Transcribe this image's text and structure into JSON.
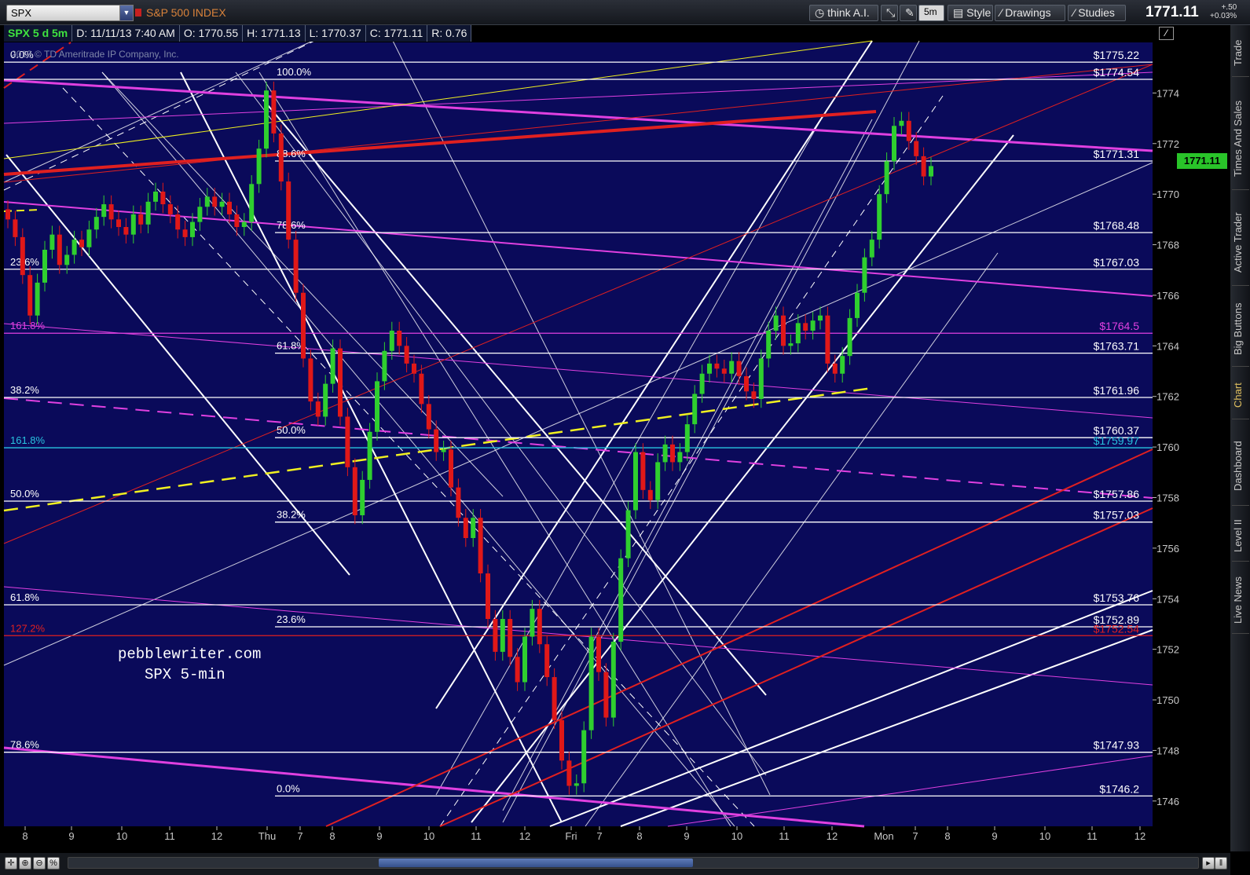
{
  "toolbar": {
    "symbol": "SPX",
    "symbol_name": "S&P 500 INDEX",
    "think_ai": "think A.I.",
    "interval": "5m",
    "style": "Style",
    "drawings": "Drawings",
    "studies": "Studies",
    "last_price": "1771.11",
    "net_change": "+.50",
    "pct_change": "+0.03%"
  },
  "infobar": {
    "study": "SPX 5 d 5m",
    "date": "D: 11/11/13 7:40 AM",
    "open": "O: 1770.55",
    "high": "H: 1771.13",
    "low": "L: 1770.37",
    "close": "C: 1771.11",
    "range": "R: 0.76"
  },
  "copyright": "2013 © TD Ameritrade IP Company, Inc.",
  "watermark": {
    "line1": "pebblewriter.com",
    "line2": "SPX 5-min"
  },
  "sidebar_tabs": [
    "Trade",
    "Times And Sales",
    "Active Trader",
    "Big Buttons",
    "Chart",
    "Dashboard",
    "Level II",
    "Live News"
  ],
  "colors": {
    "chart_bg": "#0a0a5a",
    "up": "#2fcf2f",
    "down": "#e01818",
    "magenta": "#e040e0",
    "yellow": "#f0f020",
    "cyan": "#29c4e0",
    "red_line": "#e02020"
  },
  "chart_data": {
    "type": "candlestick",
    "title": "SPX 5 d 5m",
    "ylim": [
      1745,
      1776
    ],
    "y_ticks": [
      1746,
      1748,
      1750,
      1752,
      1754,
      1756,
      1758,
      1760,
      1762,
      1764,
      1766,
      1768,
      1770,
      1772,
      1774
    ],
    "x_labels": [
      "8",
      "9",
      "10",
      "11",
      "12",
      "Thu",
      "7",
      "8",
      "9",
      "10",
      "11",
      "12",
      "Fri",
      "7",
      "8",
      "9",
      "10",
      "11",
      "12",
      "Mon",
      "7",
      "8",
      "9",
      "10",
      "11",
      "12"
    ],
    "current_price_label": "1771.11",
    "right_levels": [
      {
        "label": "$1775.22",
        "value": 1775.22,
        "color": "#ffffff"
      },
      {
        "label": "$1774.54",
        "value": 1774.54,
        "color": "#ffffff"
      },
      {
        "label": "$1771.31",
        "value": 1771.31,
        "color": "#ffffff"
      },
      {
        "label": "$1768.48",
        "value": 1768.48,
        "color": "#ffffff"
      },
      {
        "label": "$1767.03",
        "value": 1767.03,
        "color": "#ffffff"
      },
      {
        "label": "$1764.5",
        "value": 1764.5,
        "color": "#e040e0"
      },
      {
        "label": "$1763.71",
        "value": 1763.71,
        "color": "#ffffff"
      },
      {
        "label": "$1761.96",
        "value": 1761.96,
        "color": "#ffffff"
      },
      {
        "label": "$1760.37",
        "value": 1760.37,
        "color": "#ffffff"
      },
      {
        "label": "$1759.97",
        "value": 1759.97,
        "color": "#29c4e0"
      },
      {
        "label": "$1757.86",
        "value": 1757.86,
        "color": "#ffffff"
      },
      {
        "label": "$1757.03",
        "value": 1757.03,
        "color": "#ffffff"
      },
      {
        "label": "$1753.76",
        "value": 1753.76,
        "color": "#ffffff"
      },
      {
        "label": "$1752.89",
        "value": 1752.89,
        "color": "#ffffff"
      },
      {
        "label": "$1752.54",
        "value": 1752.54,
        "color": "#e02020"
      },
      {
        "label": "$1747.93",
        "value": 1747.93,
        "color": "#ffffff"
      },
      {
        "label": "$1746.2",
        "value": 1746.2,
        "color": "#ffffff"
      }
    ],
    "fib_labels_left": [
      {
        "text": "0.0%",
        "value": 1775.22,
        "color": "#ffffff"
      },
      {
        "text": "23.6%",
        "value": 1767.03,
        "color": "#ffffff"
      },
      {
        "text": "161.8%",
        "value": 1764.5,
        "color": "#e040e0"
      },
      {
        "text": "38.2%",
        "value": 1761.96,
        "color": "#ffffff"
      },
      {
        "text": "161.8%",
        "value": 1759.97,
        "color": "#29c4e0"
      },
      {
        "text": "50.0%",
        "value": 1757.86,
        "color": "#ffffff"
      },
      {
        "text": "61.8%",
        "value": 1753.76,
        "color": "#ffffff"
      },
      {
        "text": "127.2%",
        "value": 1752.54,
        "color": "#e02020"
      },
      {
        "text": "78.6%",
        "value": 1747.93,
        "color": "#ffffff"
      }
    ],
    "fib_labels_mid": [
      {
        "text": "100.0%",
        "value": 1774.54
      },
      {
        "text": "88.6%",
        "value": 1771.31
      },
      {
        "text": "78.6%",
        "value": 1768.48
      },
      {
        "text": "61.8%",
        "value": 1763.71
      },
      {
        "text": "50.0%",
        "value": 1760.37
      },
      {
        "text": "38.2%",
        "value": 1757.03
      },
      {
        "text": "23.6%",
        "value": 1752.89
      },
      {
        "text": "0.0%",
        "value": 1746.2
      }
    ],
    "closes": [
      1769,
      1768.3,
      1766.8,
      1765.2,
      1766.5,
      1767.8,
      1768.4,
      1767.2,
      1767.6,
      1768.2,
      1767.9,
      1768.6,
      1769.1,
      1769.6,
      1769.0,
      1768.7,
      1768.4,
      1769.2,
      1768.8,
      1769.7,
      1770.1,
      1769.6,
      1769.2,
      1768.6,
      1768.3,
      1768.9,
      1769.5,
      1769.9,
      1769.5,
      1769.7,
      1769.2,
      1768.7,
      1768.9,
      1770.4,
      1771.8,
      1774.1,
      1772.4,
      1770.5,
      1768.2,
      1766.1,
      1763.5,
      1761.8,
      1761.2,
      1762.5,
      1763.9,
      1761.2,
      1759.2,
      1757.3,
      1758.7,
      1760.6,
      1762.6,
      1763.8,
      1764.6,
      1764.0,
      1763.3,
      1762.9,
      1761.7,
      1760.7,
      1759.8,
      1759.9,
      1758.4,
      1757.2,
      1756.4,
      1757.2,
      1755.0,
      1753.2,
      1751.9,
      1753.2,
      1751.7,
      1750.7,
      1752.5,
      1753.6,
      1752.2,
      1750.9,
      1749.2,
      1747.6,
      1746.6,
      1746.7,
      1748.8,
      1752.5,
      1751.1,
      1749.3,
      1752.3,
      1755.6,
      1757.5,
      1759.8,
      1758.3,
      1757.9,
      1759.4,
      1760.1,
      1759.4,
      1759.8,
      1760.9,
      1762.1,
      1762.9,
      1763.3,
      1763.1,
      1762.9,
      1763.4,
      1762.8,
      1762.2,
      1761.9,
      1763.5,
      1764.6,
      1765.2,
      1764.0,
      1764.1,
      1764.9,
      1764.6,
      1765.0,
      1765.2,
      1763.3,
      1762.9,
      1763.6,
      1765.1,
      1766.1,
      1767.5,
      1768.2,
      1770.0,
      1771.3,
      1772.7,
      1772.9,
      1772.1,
      1771.5,
      1770.7,
      1771.11
    ]
  }
}
